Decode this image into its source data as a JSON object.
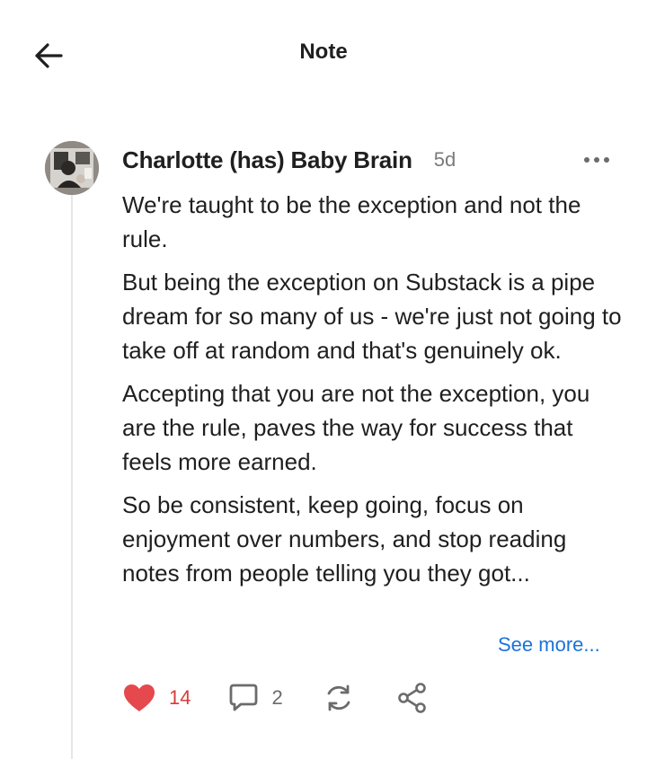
{
  "header": {
    "title": "Note",
    "back_icon": "arrow-left-icon"
  },
  "post": {
    "author": "Charlotte (has) Baby Brain",
    "timestamp": "5d",
    "paragraphs": [
      "We're taught to be the exception and not the rule.",
      "But being the exception on Substack is a pipe dream for so many of us - we're just not going to take off at random and that's genuinely ok.",
      "Accepting that you are not the exception, you are the rule, paves the way for success that feels more earned.",
      "So be consistent, keep going, focus on enjoyment over numbers, and stop reading notes from people telling you they got..."
    ],
    "see_more_label": "See more..."
  },
  "actions": {
    "likes": "14",
    "comments": "2",
    "like_color": "#e5484d",
    "link_color": "#1a73d9"
  }
}
